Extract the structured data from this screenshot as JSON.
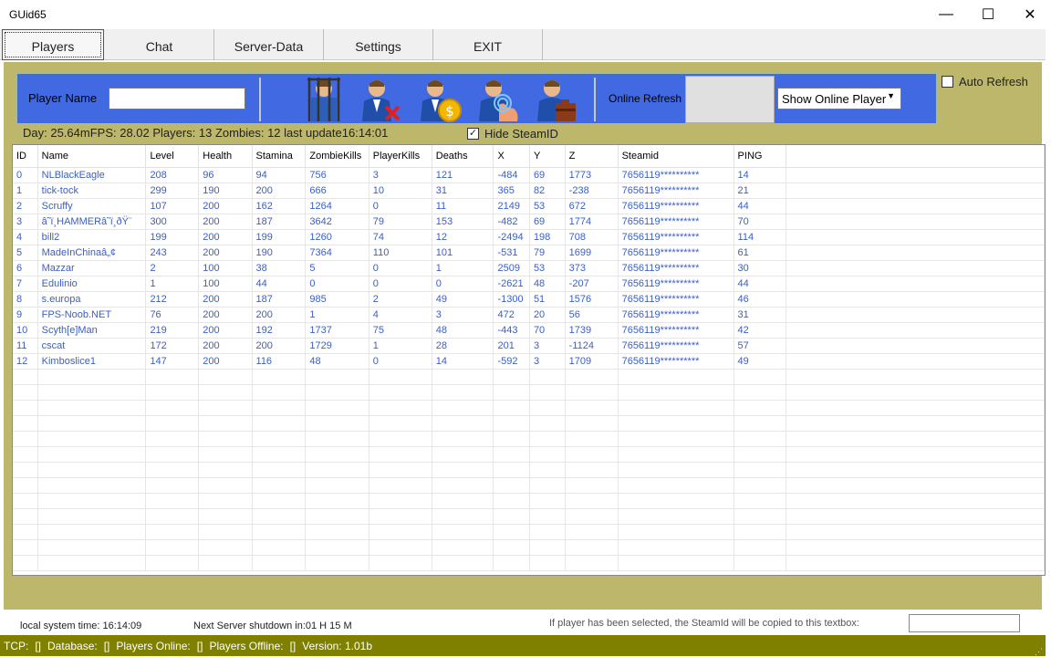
{
  "window": {
    "title": "GUid65",
    "minimize_glyph": "—",
    "maximize_glyph": "☐",
    "close_glyph": "✕"
  },
  "tabs": [
    {
      "label": "Players"
    },
    {
      "label": "Chat"
    },
    {
      "label": "Server-Data"
    },
    {
      "label": "Settings"
    },
    {
      "label": "EXIT"
    }
  ],
  "toolbar": {
    "player_name_label": "Player Name",
    "player_name_value": "",
    "icons": [
      "jail-player-icon",
      "kick-player-icon",
      "give-money-icon",
      "teleport-player-icon",
      "give-items-icon"
    ],
    "online_refresh_label": "Online Refresh",
    "show_select": "Show Online Player",
    "auto_refresh_label": "Auto Refresh"
  },
  "status": {
    "line": "Day: 25.64mFPS: 28.02 Players: 13 Zombies: 12 last update16:14:01",
    "hide_steamid_label": "Hide SteamID",
    "hide_steamid_checked": "✓"
  },
  "table": {
    "columns": [
      "ID",
      "Name",
      "Level",
      "Health",
      "Stamina",
      "ZombieKills",
      "PlayerKills",
      "Deaths",
      "X",
      "Y",
      "Z",
      "Steamid",
      "PING"
    ],
    "rows": [
      [
        "0",
        "NLBlackEagle",
        "208",
        "96",
        "94",
        "756",
        "3",
        "121",
        "-484",
        "69",
        "1773",
        "7656119**********",
        "14"
      ],
      [
        "1",
        "tick-tock",
        "299",
        "190",
        "200",
        "666",
        "10",
        "31",
        "365",
        "82",
        "-238",
        "7656119**********",
        "21"
      ],
      [
        "2",
        "Scruffy",
        "107",
        "200",
        "162",
        "1264",
        "0",
        "11",
        "2149",
        "53",
        "672",
        "7656119**********",
        "44"
      ],
      [
        "3",
        "â˜ï¸HAMMERâ˜ï¸ðŸ¨",
        "300",
        "200",
        "187",
        "3642",
        "79",
        "153",
        "-482",
        "69",
        "1774",
        "7656119**********",
        "70"
      ],
      [
        "4",
        "bill2",
        "199",
        "200",
        "199",
        "1260",
        "74",
        "12",
        "-2494",
        "198",
        "708",
        "7656119**********",
        "114"
      ],
      [
        "5",
        "MadeInChinaâ„¢",
        "243",
        "200",
        "190",
        "7364",
        "110",
        "101",
        "-531",
        "79",
        "1699",
        "7656119**********",
        "61"
      ],
      [
        "6",
        "Mazzar",
        "2",
        "100",
        "38",
        "5",
        "0",
        "1",
        "2509",
        "53",
        "373",
        "7656119**********",
        "30"
      ],
      [
        "7",
        "Edulinio",
        "1",
        "100",
        "44",
        "0",
        "0",
        "0",
        "-2621",
        "48",
        "-207",
        "7656119**********",
        "44"
      ],
      [
        "8",
        "s.europa",
        "212",
        "200",
        "187",
        "985",
        "2",
        "49",
        "-1300",
        "51",
        "1576",
        "7656119**********",
        "46"
      ],
      [
        "9",
        "FPS-Noob.NET",
        "76",
        "200",
        "200",
        "1",
        "4",
        "3",
        "472",
        "20",
        "56",
        "7656119**********",
        "31"
      ],
      [
        "10",
        "Scyth[e]Man",
        "219",
        "200",
        "192",
        "1737",
        "75",
        "48",
        "-443",
        "70",
        "1739",
        "7656119**********",
        "42"
      ],
      [
        "11",
        "cscat",
        "172",
        "200",
        "200",
        "1729",
        "1",
        "28",
        "201",
        "3",
        "-1124",
        "7656119**********",
        "57"
      ],
      [
        "12",
        "Kimboslice1",
        "147",
        "200",
        "116",
        "48",
        "0",
        "14",
        "-592",
        "3",
        "1709",
        "7656119**********",
        "49"
      ]
    ]
  },
  "footer": {
    "local_time": "local system time:  16:14:09",
    "shutdown": "Next Server shutdown in:01 H 15 M",
    "steamid_hint": "If player has been selected, the SteamId will  be copied to this textbox:",
    "steamid_value": ""
  },
  "statusbar": {
    "tcp": "TCP:",
    "tcp_val": "[]",
    "database": "Database:",
    "database_val": "[]",
    "players_online": "Players Online:",
    "players_online_val": "[]",
    "players_offline": "Players Offline:",
    "players_offline_val": "[]",
    "version": "Version: 1.01b"
  },
  "colors": {
    "panel": "#bdb76b",
    "toolbar": "#4169e1",
    "statusbar": "#808000",
    "cell_text": "#3a5fc4"
  }
}
